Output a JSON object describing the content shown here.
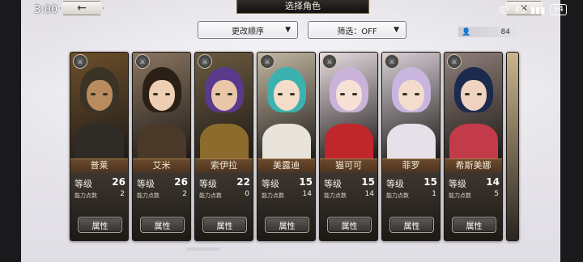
{
  "status_bar": {
    "time": "3:00",
    "signal": "46",
    "battery": "94"
  },
  "top_bar": {
    "back_glyph": "←",
    "title": "选择角色",
    "corner_glyph": "✕"
  },
  "controls": {
    "sort_label": "更改顺序",
    "filter_label": "筛选：OFF",
    "dropdown_glyph": "▼",
    "count_value": "84"
  },
  "labels": {
    "level": "等级",
    "points": "能力点数",
    "attribute_button": "属性"
  },
  "characters": [
    {
      "name": "普莱",
      "level": "26",
      "points": "2",
      "badge": "⚔",
      "bg": "#6d4f2a",
      "hair": "#3c3327",
      "skin": "#b98b5e",
      "outfit": "#2f2b26"
    },
    {
      "name": "艾米",
      "level": "26",
      "points": "2",
      "badge": "⚔",
      "bg": "#8a7560",
      "hair": "#2c2016",
      "skin": "#efcfb3",
      "outfit": "#4a3828"
    },
    {
      "name": "索伊拉",
      "level": "22",
      "points": "0",
      "badge": "⚔",
      "bg": "#6b5a3e",
      "hair": "#5a3a8c",
      "skin": "#eac6a8",
      "outfit": "#8c6b2c"
    },
    {
      "name": "美露迪",
      "level": "15",
      "points": "14",
      "badge": "⚔",
      "bg": "#c3b8a3",
      "hair": "#3bb2b0",
      "skin": "#f3dcc8",
      "outfit": "#e8e4dc"
    },
    {
      "name": "猫可可",
      "level": "15",
      "points": "14",
      "badge": "⚔",
      "bg": "#e7dde2",
      "hair": "#c9b3d9",
      "skin": "#f7e1d6",
      "outfit": "#c0272d"
    },
    {
      "name": "菲罗",
      "level": "15",
      "points": "1",
      "badge": "⚔",
      "bg": "#d8d0d6",
      "hair": "#c8b6e0",
      "skin": "#f4dccd",
      "outfit": "#e6e1e8"
    },
    {
      "name": "希斯美娜",
      "level": "14",
      "points": "5",
      "badge": "⚔",
      "bg": "#8f7f7a",
      "hair": "#1c2a4e",
      "skin": "#f0d2c0",
      "outfit": "#c33a4a"
    }
  ]
}
